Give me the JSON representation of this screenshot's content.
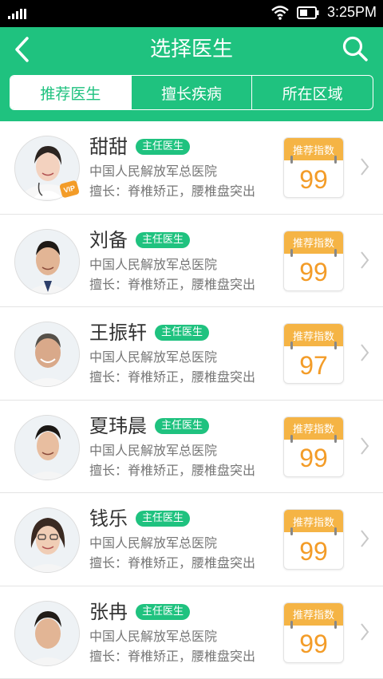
{
  "status_bar": {
    "time": "3:25PM"
  },
  "header": {
    "title": "选择医生"
  },
  "tabs": [
    {
      "label": "推荐医生",
      "active": true
    },
    {
      "label": "擅长疾病",
      "active": false
    },
    {
      "label": "所在区域",
      "active": false
    }
  ],
  "doctors": [
    {
      "name": "甜甜",
      "title": "主任医生",
      "hospital": "中国人民解放军总医院",
      "specialty": "擅长：脊椎矫正，腰椎盘突出",
      "score_label": "推荐指数",
      "score": "99",
      "vip_badge": "VIP"
    },
    {
      "name": "刘备",
      "title": "主任医生",
      "hospital": "中国人民解放军总医院",
      "specialty": "擅长：脊椎矫正，腰椎盘突出",
      "score_label": "推荐指数",
      "score": "99"
    },
    {
      "name": "王振轩",
      "title": "主任医生",
      "hospital": "中国人民解放军总医院",
      "specialty": "擅长：脊椎矫正，腰椎盘突出",
      "score_label": "推荐指数",
      "score": "97"
    },
    {
      "name": "夏玮晨",
      "title": "主任医生",
      "hospital": "中国人民解放军总医院",
      "specialty": "擅长：脊椎矫正，腰椎盘突出",
      "score_label": "推荐指数",
      "score": "99"
    },
    {
      "name": "钱乐",
      "title": "主任医生",
      "hospital": "中国人民解放军总医院",
      "specialty": "擅长：脊椎矫正，腰椎盘突出",
      "score_label": "推荐指数",
      "score": "99"
    },
    {
      "name": "张冉",
      "title": "主任医生",
      "hospital": "中国人民解放军总医院",
      "specialty": "擅长：脊椎矫正，腰椎盘突出",
      "score_label": "推荐指数",
      "score": "99"
    }
  ],
  "colors": {
    "primary": "#1fc27f",
    "score_header": "#f5b445",
    "score_value": "#f39c28"
  },
  "icons": {
    "back": "chevron-left-icon",
    "search": "search-icon",
    "row_arrow": "chevron-right-icon",
    "wifi": "wifi-icon",
    "battery": "battery-icon",
    "signal": "signal-icon"
  }
}
